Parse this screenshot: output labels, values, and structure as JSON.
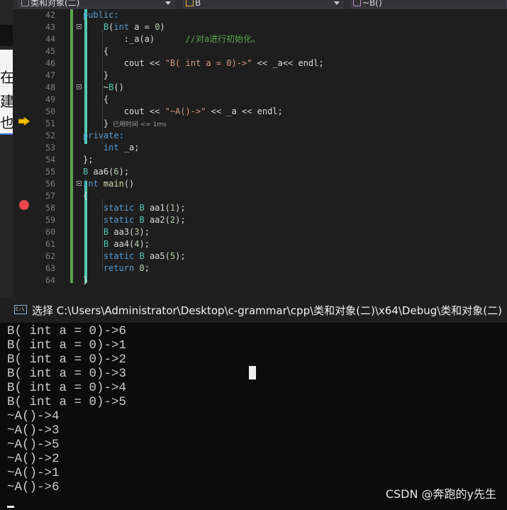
{
  "toolbar": {
    "project_combo": "类和对象(二)",
    "class_combo": "B",
    "member_combo": "~B()"
  },
  "left_strip": {
    "chars": [
      "在",
      "建",
      "也"
    ]
  },
  "editor": {
    "breakpoint_line": "58",
    "execution_line": "51",
    "lines": [
      {
        "n": "42",
        "tokens": [
          {
            "t": "public:",
            "c": "kw"
          }
        ]
      },
      {
        "n": "43",
        "tokens": [
          {
            "t": "    ",
            "c": ""
          },
          {
            "t": "B",
            "c": "typ"
          },
          {
            "t": "(",
            "c": ""
          },
          {
            "t": "int",
            "c": "kw"
          },
          {
            "t": " a = ",
            "c": ""
          },
          {
            "t": "0",
            "c": "num"
          },
          {
            "t": ")",
            "c": ""
          }
        ]
      },
      {
        "n": "44",
        "tokens": [
          {
            "t": "        :_a(a)      ",
            "c": ""
          },
          {
            "t": "//对a进行初始化。",
            "c": "cm"
          }
        ]
      },
      {
        "n": "45",
        "tokens": [
          {
            "t": "    {",
            "c": ""
          }
        ]
      },
      {
        "n": "46",
        "tokens": [
          {
            "t": "        cout << ",
            "c": ""
          },
          {
            "t": "\"B( int a = 0)->\"",
            "c": "str"
          },
          {
            "t": " << _a<< endl;",
            "c": ""
          }
        ]
      },
      {
        "n": "47",
        "tokens": [
          {
            "t": "    }",
            "c": ""
          }
        ]
      },
      {
        "n": "48",
        "tokens": [
          {
            "t": "    ~",
            "c": ""
          },
          {
            "t": "B",
            "c": "typ"
          },
          {
            "t": "()",
            "c": ""
          }
        ]
      },
      {
        "n": "49",
        "tokens": [
          {
            "t": "    {",
            "c": ""
          }
        ]
      },
      {
        "n": "50",
        "tokens": [
          {
            "t": "        cout << ",
            "c": ""
          },
          {
            "t": "\"~A()->\"",
            "c": "str"
          },
          {
            "t": " << _a << endl;",
            "c": ""
          }
        ]
      },
      {
        "n": "51",
        "tokens": [
          {
            "t": "    }",
            "c": ""
          },
          {
            "t": "  已用时间 <= 1ms",
            "c": "hint"
          }
        ]
      },
      {
        "n": "52",
        "tokens": [
          {
            "t": "private:",
            "c": "kw"
          }
        ]
      },
      {
        "n": "53",
        "tokens": [
          {
            "t": "    ",
            "c": ""
          },
          {
            "t": "int",
            "c": "kw"
          },
          {
            "t": " _a;",
            "c": ""
          }
        ]
      },
      {
        "n": "54",
        "tokens": [
          {
            "t": "};",
            "c": ""
          }
        ]
      },
      {
        "n": "55",
        "tokens": [
          {
            "t": "B",
            "c": "typ"
          },
          {
            "t": " aa6(",
            "c": ""
          },
          {
            "t": "6",
            "c": "num"
          },
          {
            "t": ");",
            "c": ""
          }
        ]
      },
      {
        "n": "56",
        "tokens": [
          {
            "t": "int",
            "c": "kw"
          },
          {
            "t": " ",
            "c": ""
          },
          {
            "t": "main",
            "c": "fn"
          },
          {
            "t": "()",
            "c": ""
          }
        ]
      },
      {
        "n": "57",
        "tokens": [
          {
            "t": "{",
            "c": ""
          }
        ]
      },
      {
        "n": "58",
        "tokens": [
          {
            "t": "    ",
            "c": ""
          },
          {
            "t": "static",
            "c": "kw"
          },
          {
            "t": " ",
            "c": ""
          },
          {
            "t": "B",
            "c": "typ"
          },
          {
            "t": " aa1(",
            "c": ""
          },
          {
            "t": "1",
            "c": "num"
          },
          {
            "t": ");",
            "c": ""
          }
        ]
      },
      {
        "n": "59",
        "tokens": [
          {
            "t": "    ",
            "c": ""
          },
          {
            "t": "static",
            "c": "kw"
          },
          {
            "t": " ",
            "c": ""
          },
          {
            "t": "B",
            "c": "typ"
          },
          {
            "t": " aa2(",
            "c": ""
          },
          {
            "t": "2",
            "c": "num"
          },
          {
            "t": ");",
            "c": ""
          }
        ]
      },
      {
        "n": "60",
        "tokens": [
          {
            "t": "    ",
            "c": ""
          },
          {
            "t": "B",
            "c": "typ"
          },
          {
            "t": " aa3(",
            "c": ""
          },
          {
            "t": "3",
            "c": "num"
          },
          {
            "t": ");",
            "c": ""
          }
        ]
      },
      {
        "n": "61",
        "tokens": [
          {
            "t": "    ",
            "c": ""
          },
          {
            "t": "B",
            "c": "typ"
          },
          {
            "t": " aa4(",
            "c": ""
          },
          {
            "t": "4",
            "c": "num"
          },
          {
            "t": ");",
            "c": ""
          }
        ]
      },
      {
        "n": "62",
        "tokens": [
          {
            "t": "    ",
            "c": ""
          },
          {
            "t": "static",
            "c": "kw"
          },
          {
            "t": " ",
            "c": ""
          },
          {
            "t": "B",
            "c": "typ"
          },
          {
            "t": " aa5(",
            "c": ""
          },
          {
            "t": "5",
            "c": "num"
          },
          {
            "t": ");",
            "c": ""
          }
        ]
      },
      {
        "n": "63",
        "tokens": [
          {
            "t": "    ",
            "c": ""
          },
          {
            "t": "return",
            "c": "kw"
          },
          {
            "t": " ",
            "c": ""
          },
          {
            "t": "0",
            "c": "num"
          },
          {
            "t": ";",
            "c": ""
          }
        ]
      },
      {
        "n": "64",
        "tokens": [
          {
            "t": "}",
            "c": ""
          }
        ]
      }
    ]
  },
  "console": {
    "title": "选择 C:\\Users\\Administrator\\Desktop\\c-grammar\\cpp\\类和对象(二)\\x64\\Debug\\类和对象(二)",
    "icon_label": "C:\\",
    "output_lines": [
      "B( int a = 0)->6",
      "B( int a = 0)->1",
      "B( int a = 0)->2",
      "B( int a = 0)->3",
      "B( int a = 0)->4",
      "B( int a = 0)->5",
      "~A()->4",
      "~A()->3",
      "~A()->5",
      "~A()->2",
      "~A()->1",
      "~A()->6"
    ],
    "watermark": "CSDN @奔跑的y先生"
  }
}
